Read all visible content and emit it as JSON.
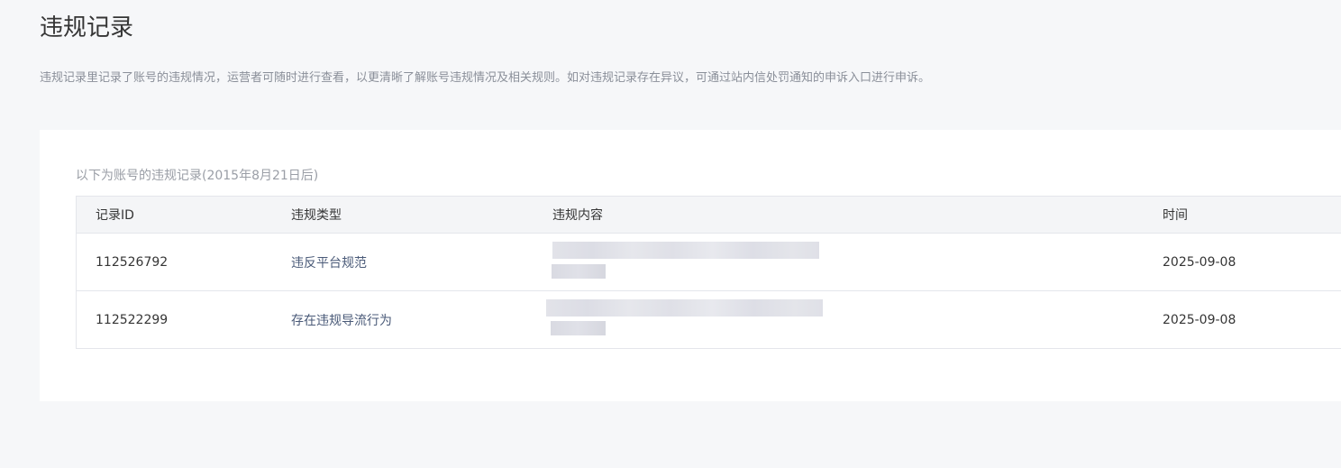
{
  "header": {
    "title": "违规记录",
    "description": "违规记录里记录了账号的违规情况，运营者可随时进行查看，以更清晰了解账号违规情况及相关规则。如对违规记录存在异议，可通过站内信处罚通知的申诉入口进行申诉。"
  },
  "records": {
    "caption": "以下为账号的违规记录(2015年8月21日后)",
    "columns": {
      "id": "记录ID",
      "type": "违规类型",
      "content": "违规内容",
      "time": "时间"
    },
    "rows": [
      {
        "id": "112526792",
        "type": "违反平台规范",
        "time": "2025-09-08"
      },
      {
        "id": "112522299",
        "type": "存在违规导流行为",
        "time": "2025-09-08"
      }
    ]
  }
}
